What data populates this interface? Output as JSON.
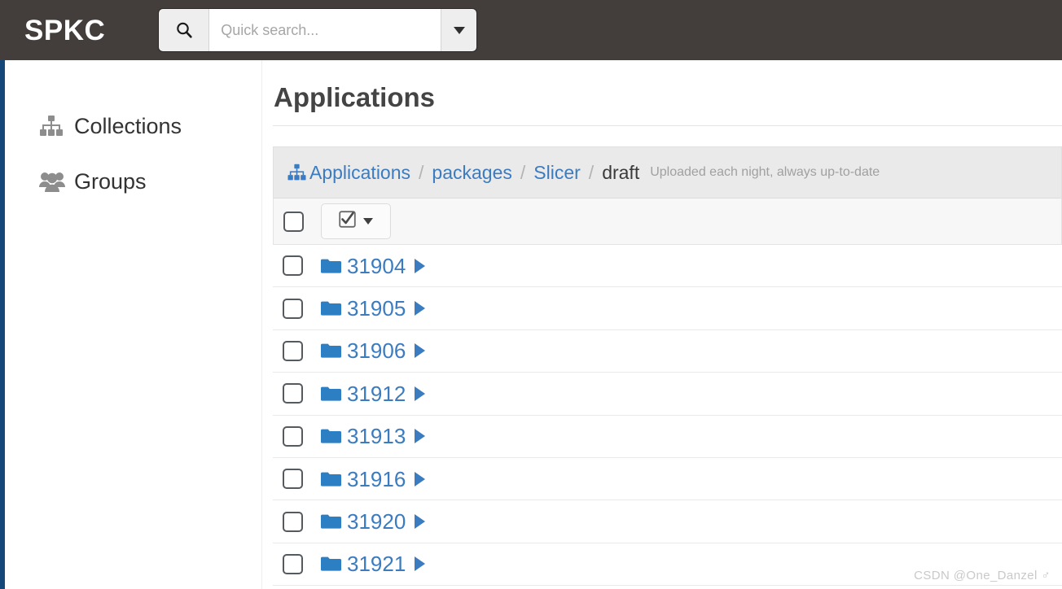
{
  "navbar": {
    "brand": "SPKC",
    "search": {
      "placeholder": "Quick search...",
      "value": "",
      "icon": "search-icon",
      "caret_icon": "caret-down-icon"
    }
  },
  "sidebar": {
    "items": [
      {
        "label": "Collections",
        "icon": "sitemap-icon"
      },
      {
        "label": "Groups",
        "icon": "users-icon"
      }
    ]
  },
  "main": {
    "page_title": "Applications",
    "breadcrumb": {
      "icon": "sitemap-icon",
      "separator": "/",
      "links": [
        {
          "label": "Applications"
        },
        {
          "label": "packages"
        },
        {
          "label": "Slicer"
        }
      ],
      "current": "draft",
      "description": "Uploaded each night, always up-to-date"
    },
    "toolbar": {
      "select_all_checked": false,
      "select_menu_icon": "checkbox-checked-icon",
      "select_menu_caret": "caret-down-icon"
    },
    "table": {
      "rows": [
        {
          "name": "31904",
          "icon": "folder-icon",
          "arrow": "caret-right-icon",
          "checked": false
        },
        {
          "name": "31905",
          "icon": "folder-icon",
          "arrow": "caret-right-icon",
          "checked": false
        },
        {
          "name": "31906",
          "icon": "folder-icon",
          "arrow": "caret-right-icon",
          "checked": false
        },
        {
          "name": "31912",
          "icon": "folder-icon",
          "arrow": "caret-right-icon",
          "checked": false
        },
        {
          "name": "31913",
          "icon": "folder-icon",
          "arrow": "caret-right-icon",
          "checked": false
        },
        {
          "name": "31916",
          "icon": "folder-icon",
          "arrow": "caret-right-icon",
          "checked": false
        },
        {
          "name": "31920",
          "icon": "folder-icon",
          "arrow": "caret-right-icon",
          "checked": false
        },
        {
          "name": "31921",
          "icon": "folder-icon",
          "arrow": "caret-right-icon",
          "checked": false
        }
      ]
    }
  },
  "watermark": "CSDN @One_Danzel ♂",
  "colors": {
    "navbar_bg": "#433d3c",
    "accent_stripe": "#154879",
    "link_blue": "#3b7bbf",
    "crumb_bar_bg": "#eaeaea",
    "toolbar_bg": "#f7f7f7",
    "title_text": "#444444"
  }
}
